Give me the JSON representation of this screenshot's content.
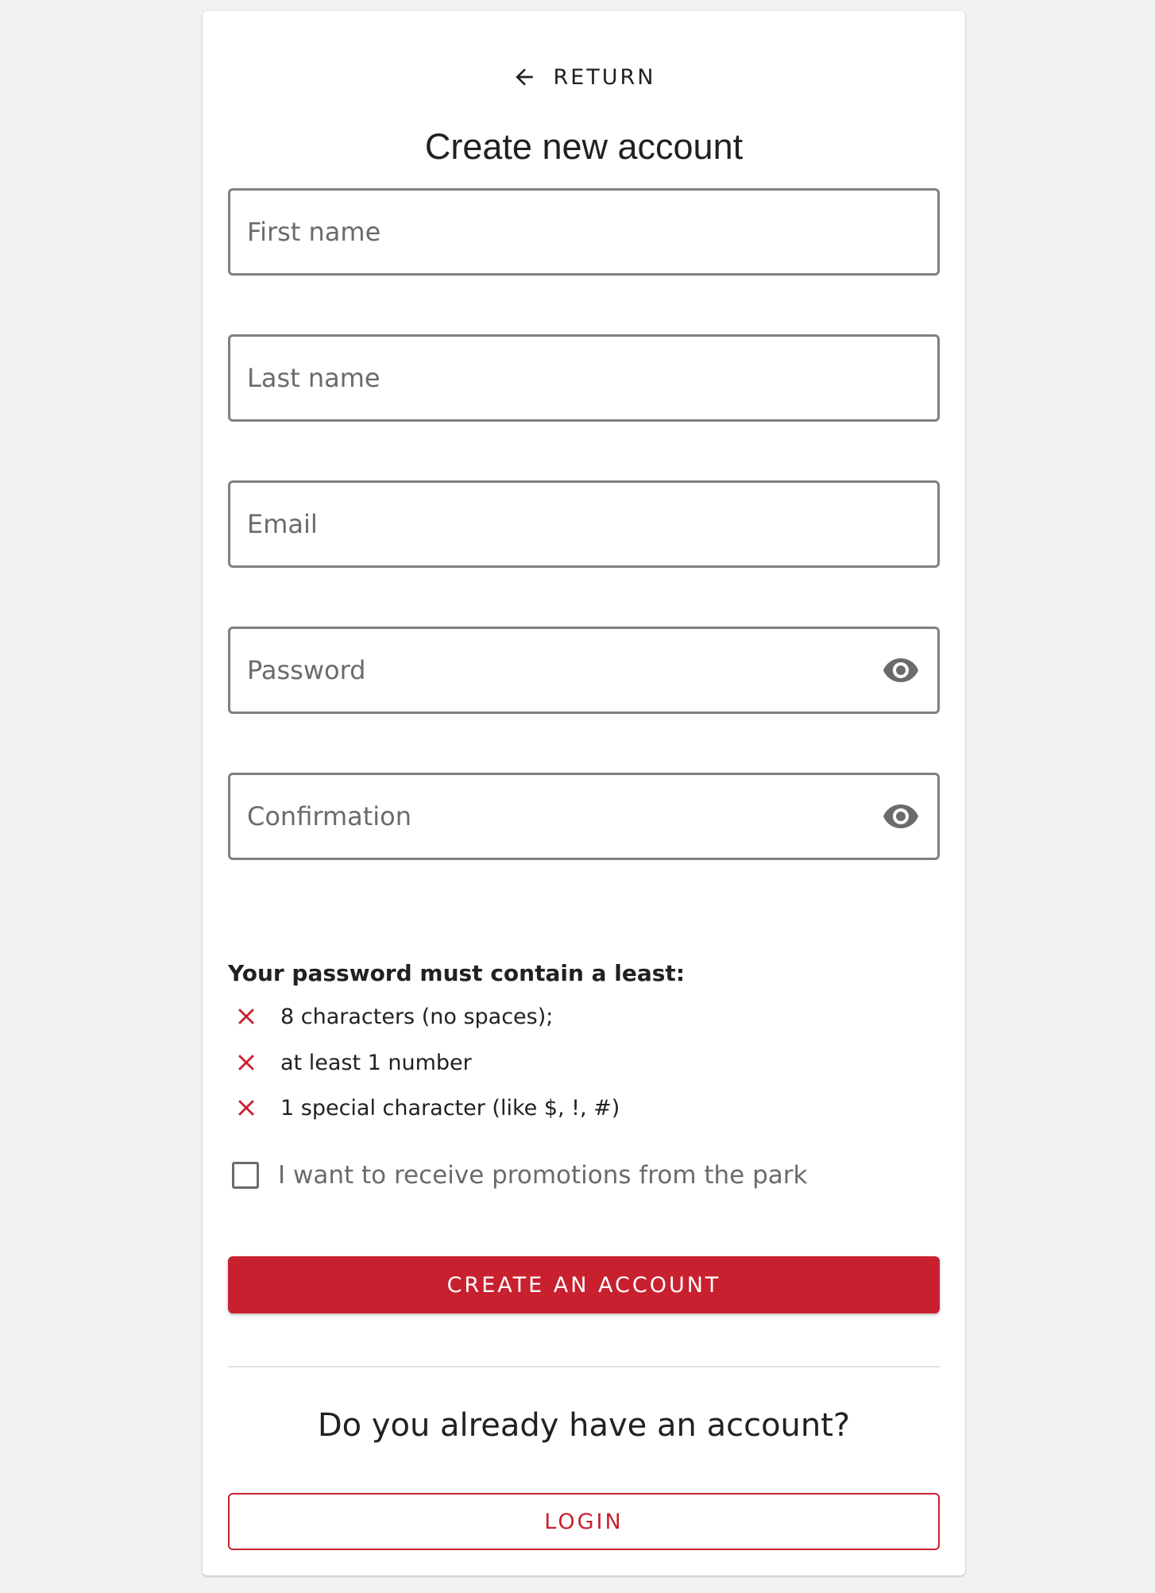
{
  "header": {
    "return_label": "RETURN",
    "title": "Create new account"
  },
  "form": {
    "first_name": {
      "placeholder": "First name",
      "value": ""
    },
    "last_name": {
      "placeholder": "Last name",
      "value": ""
    },
    "email": {
      "placeholder": "Email",
      "value": ""
    },
    "password": {
      "placeholder": "Password",
      "value": ""
    },
    "confirmation": {
      "placeholder": "Confirmation",
      "value": ""
    }
  },
  "icons": {
    "back": "arrow-left-icon",
    "show_password": "eye-icon",
    "rule_status": "close-x-icon"
  },
  "password_rules": {
    "title": "Your password must contain a least:",
    "items": [
      {
        "text": "8 characters (no spaces);",
        "satisfied": false
      },
      {
        "text": "at least 1 number",
        "satisfied": false
      },
      {
        "text": "1 special character (like $, !, #)",
        "satisfied": false
      }
    ]
  },
  "promotions": {
    "label": "I want to receive promotions from the park",
    "checked": false
  },
  "actions": {
    "create_label": "CREATE AN ACCOUNT",
    "question": "Do you already have an account?",
    "login_label": "LOGIN"
  },
  "colors": {
    "accent": "#c8202f",
    "field_border": "#808080",
    "placeholder": "#6b6b6b",
    "background": "#f2f2f2"
  }
}
